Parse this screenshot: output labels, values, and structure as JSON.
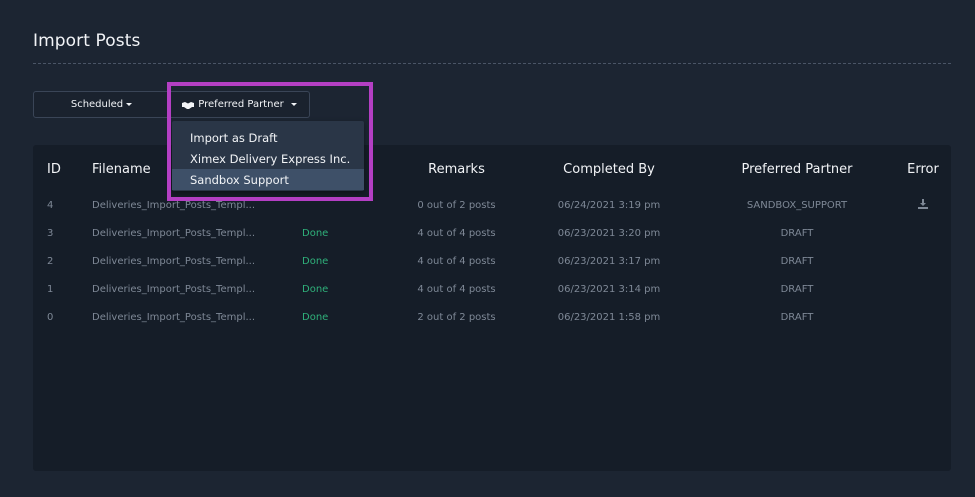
{
  "page": {
    "title": "Import Posts"
  },
  "filters": {
    "scheduled_label": "Scheduled",
    "partner_label": "Preferred Partner",
    "partner_icon": "handshake-icon"
  },
  "dropdown": {
    "items": [
      {
        "label": "Import as Draft",
        "active": false
      },
      {
        "label": "Ximex Delivery Express Inc.",
        "active": false
      },
      {
        "label": "Sandbox Support",
        "active": true
      }
    ]
  },
  "table": {
    "headers": {
      "id": "ID",
      "filename": "Filename",
      "remarks": "Remarks",
      "completed_by": "Completed By",
      "preferred_partner": "Preferred Partner",
      "error": "Error"
    },
    "rows": [
      {
        "id": "4",
        "filename": "Deliveries_Import_Posts_Templ...",
        "status": "",
        "remarks": "0 out of 2 posts",
        "completed_by": "06/24/2021 3:19 pm",
        "partner": "SANDBOX_SUPPORT",
        "error_icon": "download-icon"
      },
      {
        "id": "3",
        "filename": "Deliveries_Import_Posts_Templ...",
        "status": "Done",
        "remarks": "4 out of 4 posts",
        "completed_by": "06/23/2021 3:20 pm",
        "partner": "DRAFT",
        "error_icon": ""
      },
      {
        "id": "2",
        "filename": "Deliveries_Import_Posts_Templ...",
        "status": "Done",
        "remarks": "4 out of 4 posts",
        "completed_by": "06/23/2021 3:17 pm",
        "partner": "DRAFT",
        "error_icon": ""
      },
      {
        "id": "1",
        "filename": "Deliveries_Import_Posts_Templ...",
        "status": "Done",
        "remarks": "4 out of 4 posts",
        "completed_by": "06/23/2021 3:14 pm",
        "partner": "DRAFT",
        "error_icon": ""
      },
      {
        "id": "0",
        "filename": "Deliveries_Import_Posts_Templ...",
        "status": "Done",
        "remarks": "2 out of 2 posts",
        "completed_by": "06/23/2021 1:58 pm",
        "partner": "DRAFT",
        "error_icon": ""
      }
    ]
  },
  "colors": {
    "background": "#1c2532",
    "card": "#151d28",
    "done": "#2fb07a",
    "highlight": "#b43fc4",
    "dropdown_active": "#3e5068"
  }
}
